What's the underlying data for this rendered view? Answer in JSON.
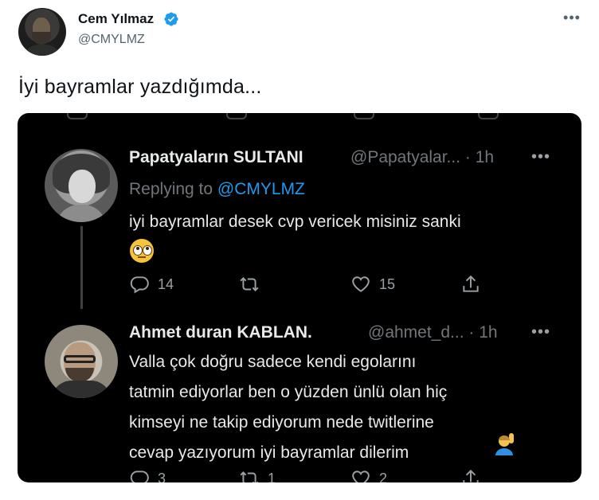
{
  "tweet": {
    "author_name": "Cem Yılmaz",
    "author_handle": "@CMYLMZ",
    "text": "İyi bayramlar yazdığımda...",
    "more_icon": "more-horizontal-icon",
    "verified_icon": "verified-badge-icon"
  },
  "screenshot": {
    "replies": [
      {
        "name": "Papatyaların SULTANI",
        "handle": "@Papatyalar... · 1h",
        "replying_label": "Replying to",
        "replying_to": "@CMYLMZ",
        "text_line1": "iyi bayramlar desek cvp vericek misiniz sanki",
        "emoji": "face-with-rolling-eyes",
        "reply_count": "14",
        "retweet_count": "",
        "like_count": "15"
      },
      {
        "name": "Ahmet duran KABLAN.",
        "handle": "@ahmet_d... · 1h",
        "text_line1": "Valla çok doğru sadece kendi egolarını",
        "text_line2": "tatmin ediyorlar ben o yüzden ünlü olan hiç",
        "text_line3": "kimseyi ne takip ediyorum nede twitlerine",
        "text_line4": "cevap yazıyorum iyi bayramlar dilerim",
        "emoji": "person-raising-hand",
        "reply_count": "3",
        "retweet_count": "1",
        "like_count": "2"
      }
    ],
    "colors": {
      "background": "#000000",
      "primary_text": "#e7e9ea",
      "secondary_text": "#71767b",
      "link": "#1d9bf0"
    }
  }
}
